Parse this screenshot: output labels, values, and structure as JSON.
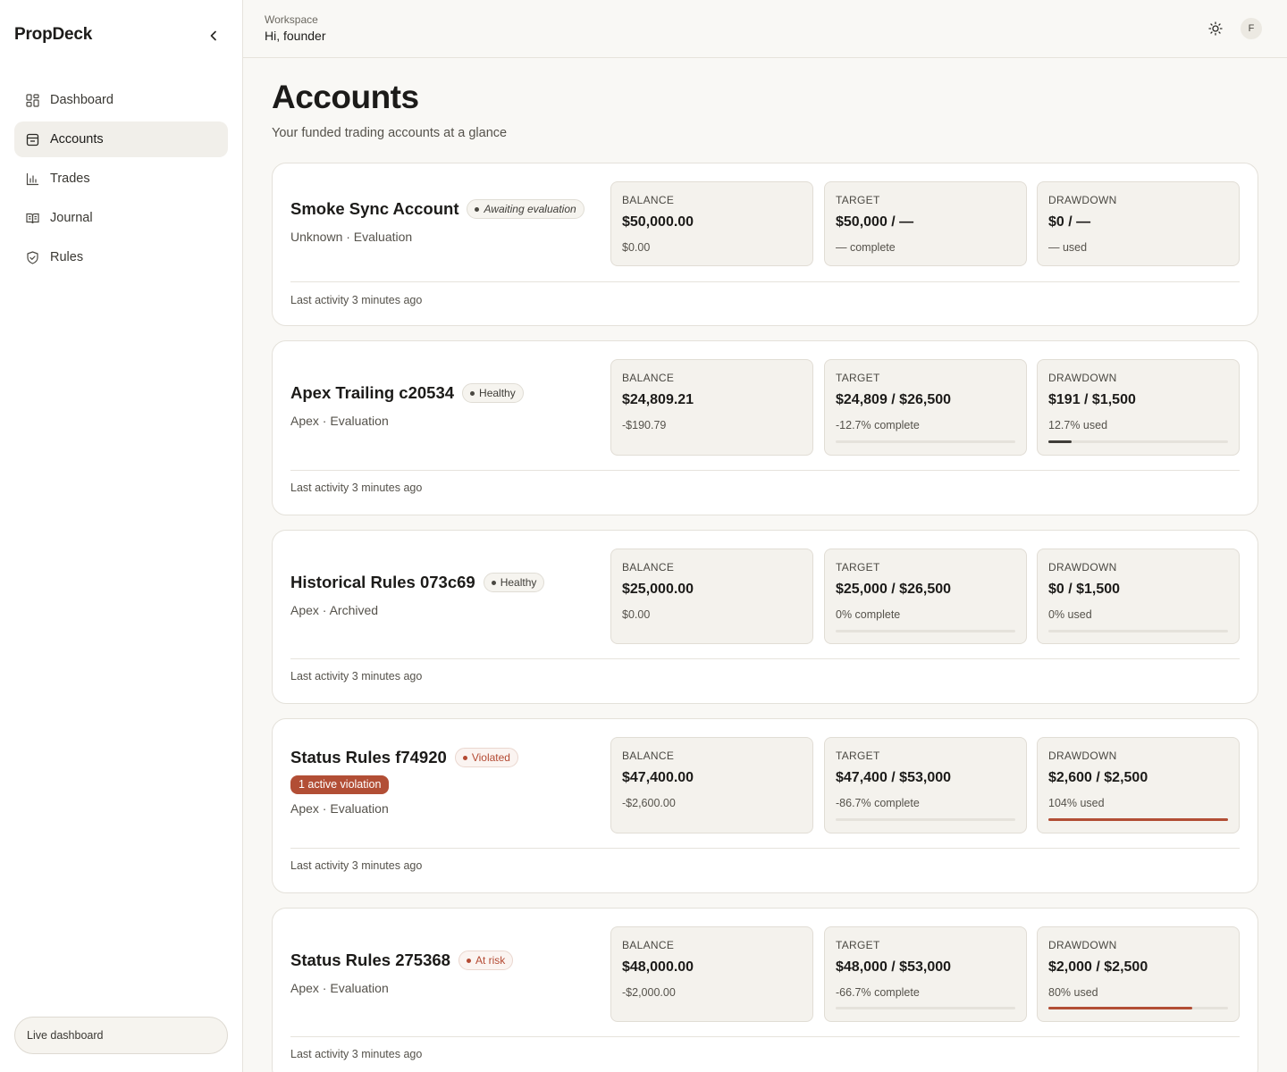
{
  "app": {
    "name": "PropDeck"
  },
  "sidebar": {
    "items": [
      {
        "label": "Dashboard",
        "icon": "dashboard-icon"
      },
      {
        "label": "Accounts",
        "icon": "accounts-icon",
        "active": true
      },
      {
        "label": "Trades",
        "icon": "chart-bar-icon"
      },
      {
        "label": "Journal",
        "icon": "book-icon"
      },
      {
        "label": "Rules",
        "icon": "shield-check-icon"
      }
    ],
    "live_label": "Live dashboard"
  },
  "header": {
    "workspace_label": "Workspace",
    "greeting": "Hi, founder",
    "avatar_initial": "F"
  },
  "page": {
    "title": "Accounts",
    "subtitle": "Your funded trading accounts at a glance"
  },
  "colors": {
    "accent_red": "#b24e35",
    "progress_dark": "#3e3c37"
  },
  "accounts": [
    {
      "name": "Smoke Sync Account",
      "status": "Awaiting evaluation",
      "meta": "Unknown · Evaluation",
      "balance_label": "BALANCE",
      "balance_value": "$50,000.00",
      "balance_sub": "$0.00",
      "target_label": "TARGET",
      "target_value": "$50,000 / —",
      "target_sub": "— complete",
      "drawdown_label": "DRAWDOWN",
      "drawdown_value": "$0 / —",
      "drawdown_sub": "— used",
      "drawdown_used_fraction": null,
      "last_activity": "Last activity 3 minutes ago"
    },
    {
      "name": "Apex Trailing c20534",
      "status": "Healthy",
      "meta": "Apex · Evaluation",
      "balance_label": "BALANCE",
      "balance_value": "$24,809.21",
      "balance_sub": "-$190.79",
      "target_label": "TARGET",
      "target_value": "$24,809 / $26,500",
      "target_sub": "-12.7% complete",
      "drawdown_label": "DRAWDOWN",
      "drawdown_value": "$191 / $1,500",
      "drawdown_sub": "12.7% used",
      "drawdown_used_fraction": 0.127,
      "last_activity": "Last activity 3 minutes ago"
    },
    {
      "name": "Historical Rules 073c69",
      "status": "Healthy",
      "meta": "Apex · Archived",
      "balance_label": "BALANCE",
      "balance_value": "$25,000.00",
      "balance_sub": "$0.00",
      "target_label": "TARGET",
      "target_value": "$25,000 / $26,500",
      "target_sub": "0% complete",
      "drawdown_label": "DRAWDOWN",
      "drawdown_value": "$0 / $1,500",
      "drawdown_sub": "0% used",
      "drawdown_used_fraction": 0,
      "last_activity": "Last activity 3 minutes ago"
    },
    {
      "name": "Status Rules f74920",
      "status": "Violated",
      "violation": "1 active violation",
      "meta": "Apex · Evaluation",
      "balance_label": "BALANCE",
      "balance_value": "$47,400.00",
      "balance_sub": "-$2,600.00",
      "target_label": "TARGET",
      "target_value": "$47,400 / $53,000",
      "target_sub": "-86.7% complete",
      "drawdown_label": "DRAWDOWN",
      "drawdown_value": "$2,600 / $2,500",
      "drawdown_sub": "104% used",
      "drawdown_used_fraction": 1.04,
      "last_activity": "Last activity 3 minutes ago"
    },
    {
      "name": "Status Rules 275368",
      "status": "At risk",
      "meta": "Apex · Evaluation",
      "balance_label": "BALANCE",
      "balance_value": "$48,000.00",
      "balance_sub": "-$2,000.00",
      "target_label": "TARGET",
      "target_value": "$48,000 / $53,000",
      "target_sub": "-66.7% complete",
      "drawdown_label": "DRAWDOWN",
      "drawdown_value": "$2,000 / $2,500",
      "drawdown_sub": "80% used",
      "drawdown_used_fraction": 0.8,
      "last_activity": "Last activity 3 minutes ago"
    }
  ]
}
